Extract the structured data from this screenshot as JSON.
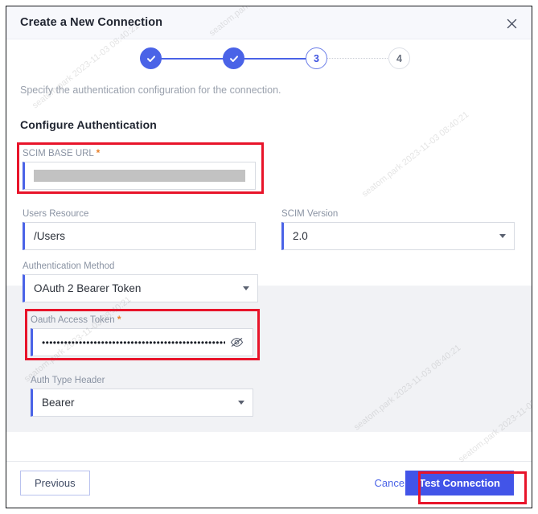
{
  "dialog": {
    "title": "Create a New Connection",
    "close_icon": "close-icon"
  },
  "stepper": {
    "steps": [
      {
        "label": "1",
        "state": "done",
        "glyph": "check-icon"
      },
      {
        "label": "2",
        "state": "done",
        "glyph": "check-icon"
      },
      {
        "label": "3",
        "state": "active",
        "glyph": "3"
      },
      {
        "label": "4",
        "state": "todo",
        "glyph": "4"
      }
    ]
  },
  "body": {
    "subtitle": "Specify the authentication configuration for the connection.",
    "section_heading": "Configure Authentication"
  },
  "fields": {
    "scim_base_url": {
      "label": "SCIM BASE URL",
      "required_marker": "*",
      "value": "",
      "redacted": true,
      "annotated": true
    },
    "users_resource": {
      "label": "Users Resource",
      "value": "/Users"
    },
    "scim_version": {
      "label": "SCIM Version",
      "value": "2.0"
    },
    "authentication_method": {
      "label": "Authentication Method",
      "value": "OAuth 2 Bearer Token"
    },
    "oauth_access_token": {
      "label": "Oauth Access Token",
      "required_marker": "*",
      "value": "••••••••••••••••••••••••••••••••••••••••••••••••••••••••",
      "reveal_icon": "eye-off-icon",
      "annotated": true
    },
    "auth_type_header": {
      "label": "Auth Type Header",
      "value": "Bearer"
    }
  },
  "footer": {
    "previous_label": "Previous",
    "cancel_label": "Cancel",
    "test_connection_label": "Test Connection"
  },
  "colors": {
    "accent_blue": "#4a63e7",
    "button_blue": "#4254e8",
    "annotation_red": "#e8142a",
    "panel_gray": "#f1f2f5",
    "required_orange": "#e8802a"
  },
  "watermark": {
    "text": "seatom.park 2023-11-03 08:40:21"
  }
}
